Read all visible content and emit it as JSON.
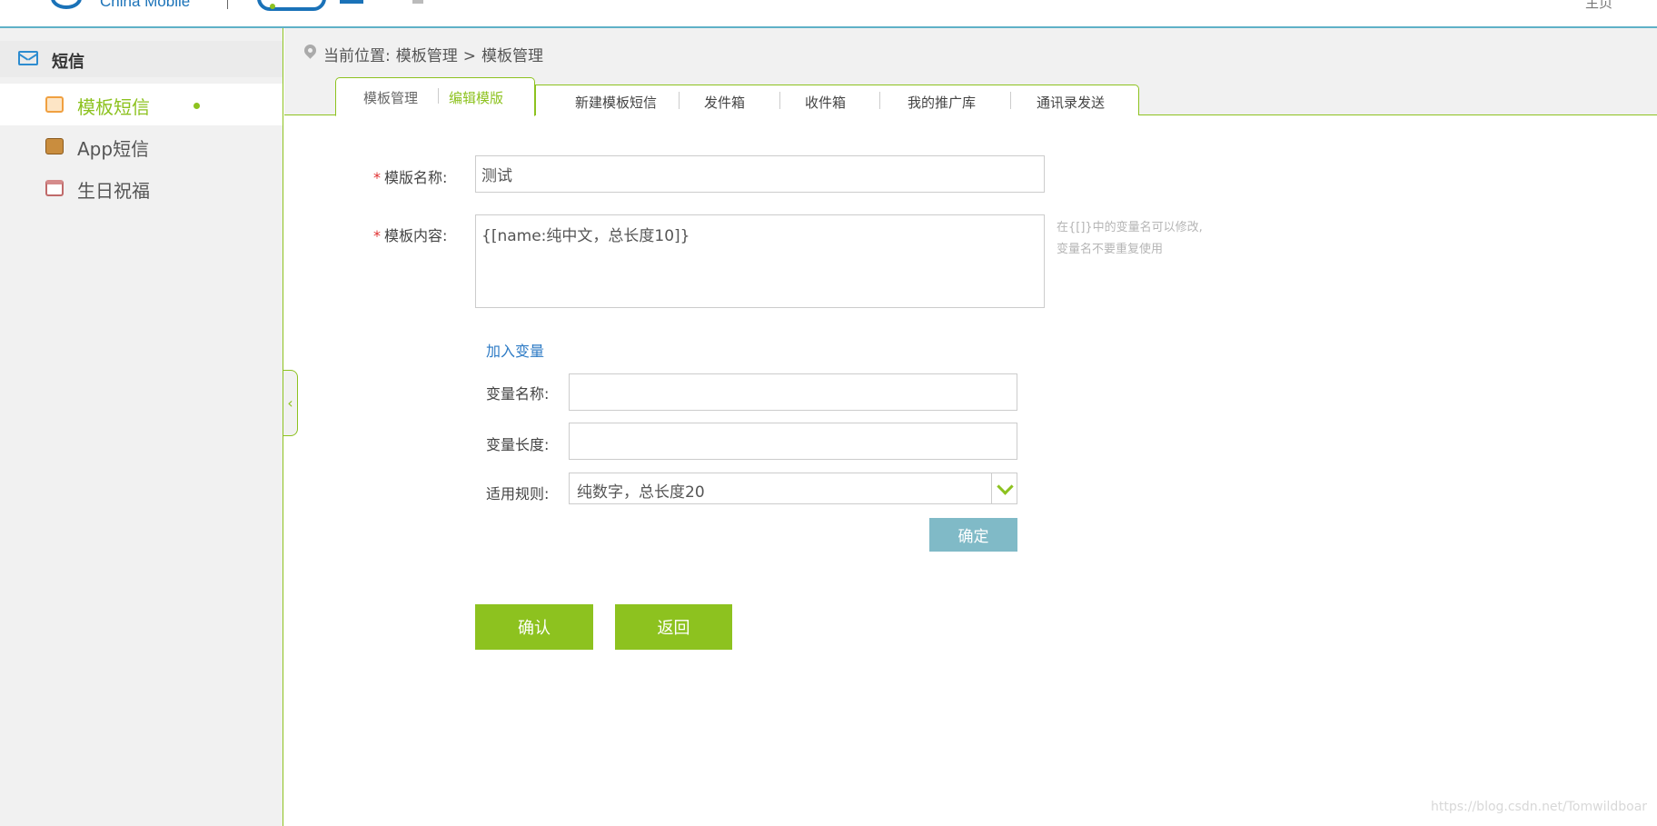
{
  "header": {
    "logo_text": "China Mobile",
    "home_link": "主页"
  },
  "sidebar": {
    "section_label": "短信",
    "items": [
      {
        "label": "模板短信",
        "active": true
      },
      {
        "label": "App短信",
        "active": false
      },
      {
        "label": "生日祝福",
        "active": false
      }
    ]
  },
  "breadcrumb": {
    "prefix": "当前位置:",
    "parent": "模板管理",
    "separator": ">",
    "current": "模板管理"
  },
  "tabs": {
    "group_first": "模板管理",
    "group_second": "编辑模版",
    "items": [
      "新建模板短信",
      "发件箱",
      "收件箱",
      "我的推广库",
      "通讯录发送"
    ]
  },
  "form": {
    "required_mark": "*",
    "name_label": "模版名称:",
    "name_value": "测试",
    "content_label": "模板内容:",
    "content_value": "{[name:纯中文，总长度10]}",
    "hint_line1": "在{[]}中的变量名可以修改,",
    "hint_line2": "变量名不要重复使用",
    "add_variable_link": "加入变量",
    "var_name_label": "变量名称:",
    "var_name_value": "",
    "var_length_label": "变量长度:",
    "var_length_value": "",
    "rule_label": "适用规则:",
    "rule_selected": "纯数字，总长度20",
    "ok_button": "确定",
    "confirm_button": "确认",
    "back_button": "返回"
  },
  "watermark": "https://blog.csdn.net/Tomwildboar"
}
